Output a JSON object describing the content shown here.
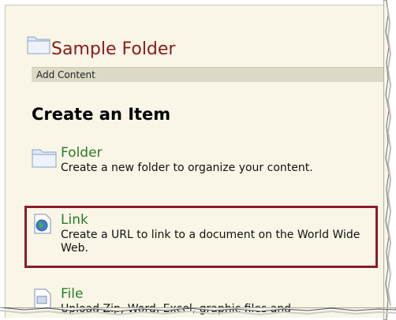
{
  "folder": {
    "title": "Sample Folder"
  },
  "action_bar": {
    "add_content": "Add Content"
  },
  "create": {
    "heading": "Create an Item",
    "items": [
      {
        "title": "Folder",
        "description": "Create a new folder to organize your content.",
        "icon": "folder-icon"
      },
      {
        "title": "Link",
        "description": "Create a URL to link to a document on the World Wide Web.",
        "icon": "web-link-icon"
      },
      {
        "title": "File",
        "description": "Upload Zip, Word, Excel, graphic files and",
        "icon": "file-icon"
      }
    ]
  },
  "colors": {
    "folder_title": "#8b1a1a",
    "item_title": "#2a7a2a",
    "highlight_border": "#8a1c2b",
    "page_background": "#f9f6e7",
    "action_bar": "#dcdac6"
  }
}
